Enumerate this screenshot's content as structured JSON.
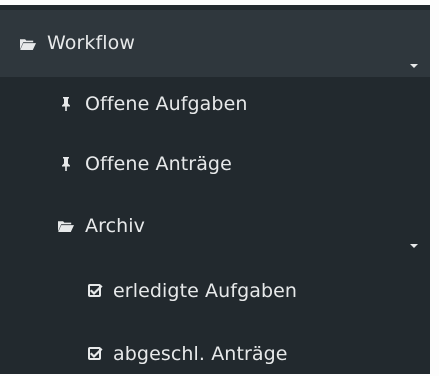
{
  "sidebar": {
    "items": [
      {
        "label": "Workflow",
        "icon": "folder-open-icon"
      },
      {
        "label": "Offene Aufgaben",
        "icon": "pin-icon"
      },
      {
        "label": "Offene Anträge",
        "icon": "pin-icon"
      },
      {
        "label": "Archiv",
        "icon": "folder-open-icon"
      },
      {
        "label": "erledigte Aufgaben",
        "icon": "checkbox-icon"
      },
      {
        "label": "abgeschl. Anträge",
        "icon": "checkbox-icon"
      }
    ]
  },
  "colors": {
    "sidebar_background": "#22292e",
    "active_row_background": "#2f373d",
    "text": "#e7e9ea"
  }
}
